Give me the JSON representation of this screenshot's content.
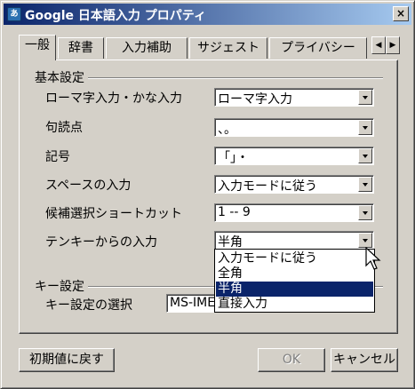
{
  "window": {
    "title": "Google 日本語入力 プロパティ",
    "close_label": "×"
  },
  "tabs": [
    {
      "label": "一般",
      "active": true
    },
    {
      "label": "辞書"
    },
    {
      "label": "入力補助"
    },
    {
      "label": "サジェスト"
    },
    {
      "label": "プライバシー"
    }
  ],
  "tab_scroll": {
    "left": "◀",
    "right": "▶"
  },
  "basic_settings": {
    "heading": "基本設定",
    "fields": [
      {
        "label": "ローマ字入力・かな入力",
        "value": "ローマ字入力"
      },
      {
        "label": "句読点",
        "value": "、。"
      },
      {
        "label": "記号",
        "value": "「」・"
      },
      {
        "label": "スペースの入力",
        "value": "入力モードに従う"
      },
      {
        "label": "候補選択ショートカット",
        "value": "1 -- 9"
      },
      {
        "label": "テンキーからの入力",
        "value": "半角"
      }
    ]
  },
  "numpad_dropdown": {
    "options": [
      "入力モードに従う",
      "全角",
      "半角",
      "直接入力"
    ],
    "highlighted_index": 2
  },
  "key_settings": {
    "heading": "キー設定",
    "label": "キー設定の選択",
    "value": "MS-IME"
  },
  "buttons": {
    "reset": "初期値に戻す",
    "ok": "OK",
    "cancel": "キャンセル"
  },
  "colors": {
    "title_gradient_start": "#0a246a",
    "title_gradient_end": "#a6caf0",
    "face": "#d4d0c8",
    "selection": "#0a246a"
  }
}
